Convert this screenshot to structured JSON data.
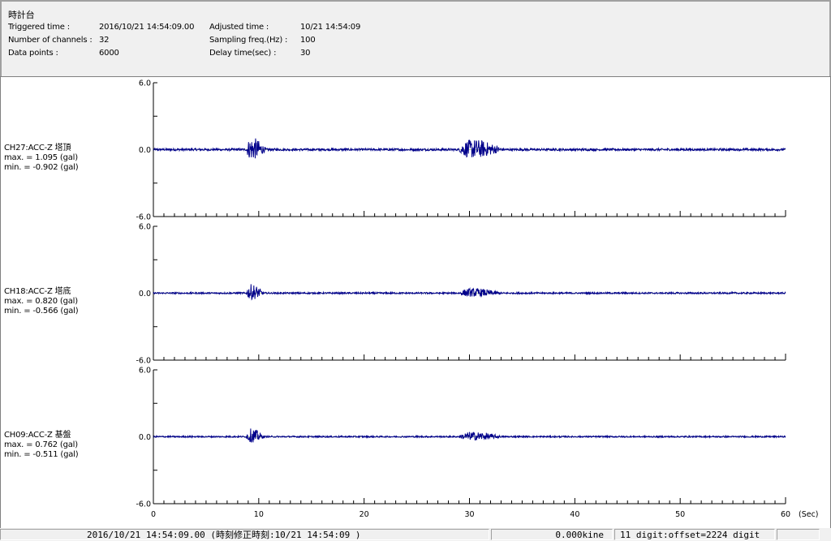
{
  "header": {
    "title": "時計台",
    "triggered_label": "Triggered time :",
    "triggered_value": "2016/10/21 14:54:09.00",
    "channels_label": "Number of channels :",
    "channels_value": "32",
    "points_label": "Data points :",
    "points_value": "6000",
    "adjusted_label": "Adjusted time :",
    "adjusted_value": "10/21 14:54:09",
    "sampling_label": "Sampling freq.(Hz) :",
    "sampling_value": "100",
    "delay_label": "Delay time(sec) :",
    "delay_value": "30"
  },
  "chart_data": {
    "type": "line",
    "xlabel": "(Sec)",
    "xlim": [
      0,
      60
    ],
    "x_ticks": [
      "0",
      "10",
      "20",
      "30",
      "40",
      "50",
      "60"
    ],
    "ylim": [
      -6.0,
      6.0
    ],
    "y_tick_labels": [
      "6.0",
      "0.0",
      "-6.0"
    ],
    "line_color": "#00008b",
    "series": [
      {
        "name": "CH27:ACC-Z 塔頂",
        "max_text": "max. = 1.095 (gal)",
        "min_text": "min. = -0.902 (gal)",
        "max": 1.095,
        "min": -0.902,
        "bursts": [
          {
            "start": 8.8,
            "end": 10.8,
            "amp": 1.0
          },
          {
            "start": 29.0,
            "end": 33.5,
            "amp": 0.85
          }
        ],
        "noise": 0.1
      },
      {
        "name": "CH18:ACC-Z 塔底",
        "max_text": "max. = 0.820 (gal)",
        "min_text": "min. = -0.566 (gal)",
        "max": 0.82,
        "min": -0.566,
        "bursts": [
          {
            "start": 8.8,
            "end": 10.6,
            "amp": 1.0
          },
          {
            "start": 29.0,
            "end": 33.5,
            "amp": 0.55
          }
        ],
        "noise": 0.1
      },
      {
        "name": "CH09:ACC-Z 基盤",
        "max_text": "max. = 0.762 (gal)",
        "min_text": "min. = -0.511 (gal)",
        "max": 0.762,
        "min": -0.511,
        "bursts": [
          {
            "start": 8.8,
            "end": 10.6,
            "amp": 1.0
          },
          {
            "start": 29.0,
            "end": 33.5,
            "amp": 0.6
          }
        ],
        "noise": 0.1
      }
    ]
  },
  "status": {
    "time": "2016/10/21 14:54:09.00  (時刻修正時刻:10/21 14:54:09  )",
    "velocity": "0.000kine",
    "digit": "11 digit:offset=2224 digit",
    "extra": ""
  }
}
